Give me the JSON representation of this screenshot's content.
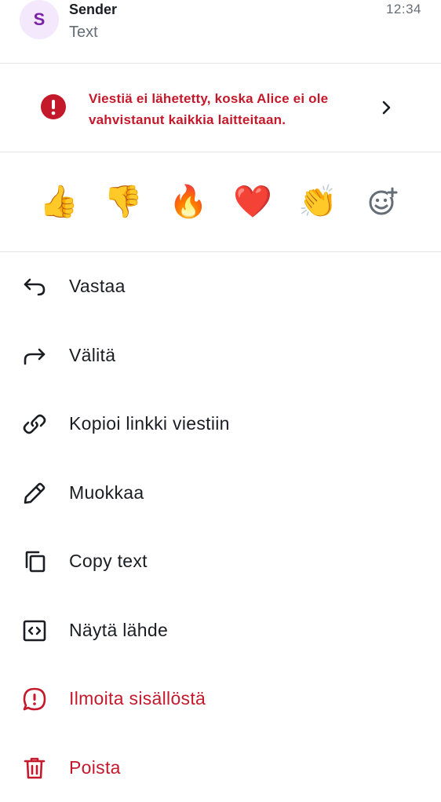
{
  "header": {
    "avatar_letter": "S",
    "sender": "Sender",
    "preview": "Text",
    "time": "12:34"
  },
  "error": {
    "message": "Viestiä ei lähetetty, koska Alice ei ole vahvistanut kaikkia laitteitaan."
  },
  "reactions": {
    "items": [
      "👍",
      "👎",
      "🔥",
      "❤️",
      "👏"
    ],
    "add_icon": "add-reaction-icon"
  },
  "menu": {
    "items": [
      {
        "label": "Vastaa",
        "icon": "reply-icon",
        "danger": false
      },
      {
        "label": "Välitä",
        "icon": "forward-icon",
        "danger": false
      },
      {
        "label": "Kopioi linkki viestiin",
        "icon": "link-icon",
        "danger": false
      },
      {
        "label": "Muokkaa",
        "icon": "edit-icon",
        "danger": false
      },
      {
        "label": "Copy text",
        "icon": "copy-icon",
        "danger": false
      },
      {
        "label": "Näytä lähde",
        "icon": "code-icon",
        "danger": false
      },
      {
        "label": "Ilmoita sisällöstä",
        "icon": "report-icon",
        "danger": true
      },
      {
        "label": "Poista",
        "icon": "delete-icon",
        "danger": true
      }
    ]
  },
  "colors": {
    "danger": "#c4192b",
    "text": "#1b1d22",
    "secondary": "#656d77",
    "avatar_bg": "#f3e8fc",
    "avatar_fg": "#7b22a6"
  }
}
